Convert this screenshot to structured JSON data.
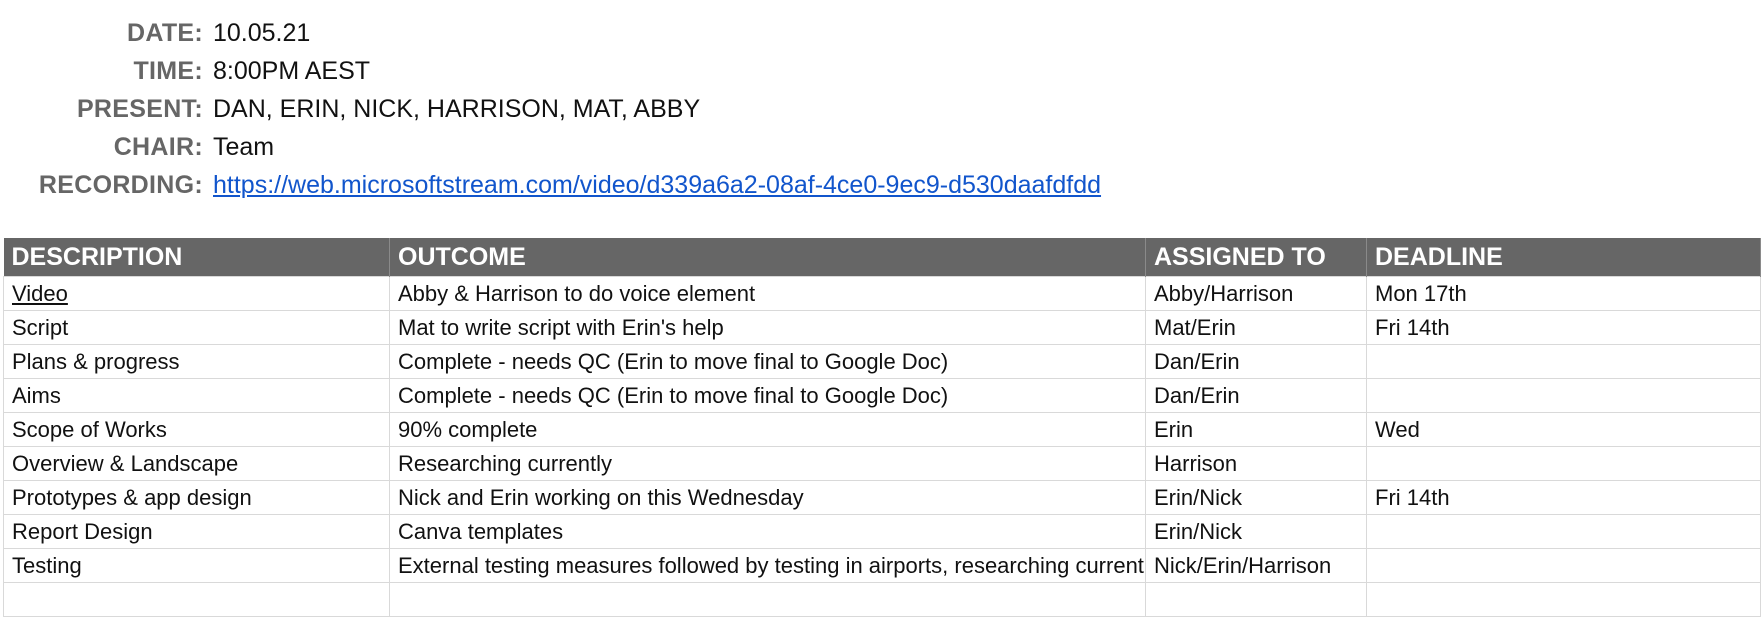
{
  "meta": {
    "date_label": "DATE:",
    "date": "10.05.21",
    "time_label": "TIME:",
    "time": "8:00PM AEST",
    "present_label": "PRESENT:",
    "present": "DAN, ERIN, NICK, HARRISON, MAT, ABBY",
    "chair_label": "CHAIR:",
    "chair": "Team",
    "recording_label": "RECORDING:",
    "recording_url": "https://web.microsoftstream.com/video/d339a6a2-08af-4ce0-9ec9-d530daafdfdd"
  },
  "table": {
    "headers": [
      "DESCRIPTION",
      "OUTCOME",
      "ASSIGNED TO",
      "DEADLINE"
    ],
    "rows": [
      {
        "description": "Video",
        "outcome": "Abby & Harrison to do voice element",
        "assigned": "Abby/Harrison",
        "deadline": "Mon 17th"
      },
      {
        "description": "Script",
        "outcome": "Mat to write script with Erin's help",
        "assigned": "Mat/Erin",
        "deadline": "Fri 14th"
      },
      {
        "description": "Plans & progress",
        "outcome": "Complete - needs QC (Erin to move final to Google Doc)",
        "assigned": "Dan/Erin",
        "deadline": ""
      },
      {
        "description": "Aims",
        "outcome": "Complete - needs QC (Erin to move final to Google Doc)",
        "assigned": "Dan/Erin",
        "deadline": ""
      },
      {
        "description": "Scope of Works",
        "outcome": "90% complete",
        "assigned": "Erin",
        "deadline": "Wed"
      },
      {
        "description": "Overview & Landscape",
        "outcome": "Researching currently",
        "assigned": "Harrison",
        "deadline": ""
      },
      {
        "description": "Prototypes & app design",
        "outcome": "Nick and Erin working on this Wednesday",
        "assigned": "Erin/Nick",
        "deadline": "Fri 14th"
      },
      {
        "description": "Report Design",
        "outcome": "Canva templates",
        "assigned": "Erin/Nick",
        "deadline": ""
      },
      {
        "description": "Testing",
        "outcome": "External testing measures followed by testing in airports, researching currently",
        "assigned": "Nick/Erin/Harrison",
        "deadline": ""
      },
      {
        "description": "",
        "outcome": "",
        "assigned": "",
        "deadline": ""
      }
    ]
  },
  "colors": {
    "label_gray": "#666666",
    "header_bg": "#666666",
    "link_blue": "#1155cc",
    "grid_line": "#d9d9d9"
  }
}
